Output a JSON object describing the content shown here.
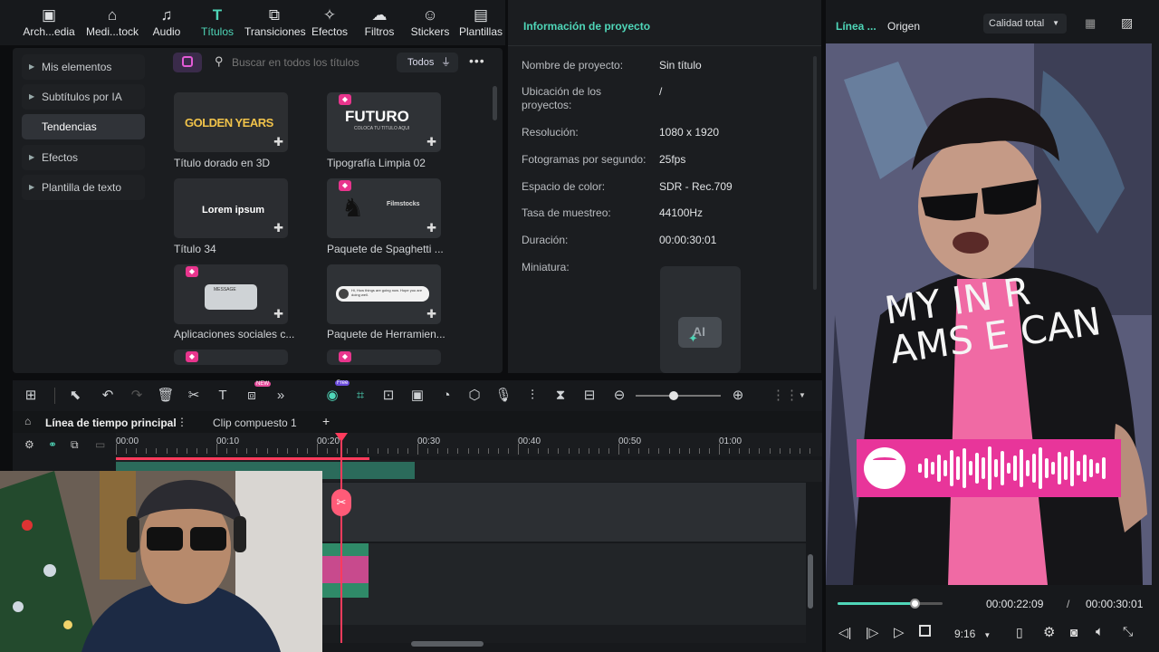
{
  "toolbar": {
    "items": [
      {
        "label": "Arch...edia",
        "icon": "folder-play-icon"
      },
      {
        "label": "Medi...tock",
        "icon": "media-stock-icon"
      },
      {
        "label": "Audio",
        "icon": "music-icon"
      },
      {
        "label": "Títulos",
        "icon": "title-t-icon",
        "active": true
      },
      {
        "label": "Transiciones",
        "icon": "transition-icon"
      },
      {
        "label": "Efectos",
        "icon": "effects-icon"
      },
      {
        "label": "Filtros",
        "icon": "filters-icon"
      },
      {
        "label": "Stickers",
        "icon": "sticker-icon"
      },
      {
        "label": "Plantillas",
        "icon": "templates-icon"
      }
    ]
  },
  "sidebar": {
    "items": [
      {
        "label": "Mis elementos",
        "expandable": true
      },
      {
        "label": "Subtítulos por IA",
        "expandable": true
      },
      {
        "label": "Tendencias",
        "selected": true
      },
      {
        "label": "Efectos",
        "expandable": true
      },
      {
        "label": "Plantilla de texto",
        "expandable": true
      }
    ]
  },
  "search": {
    "placeholder": "Buscar en todos los títulos",
    "filter_label": "Todos"
  },
  "titles": [
    {
      "caption": "Título dorado en 3D",
      "thumb_text": "GOLDEN YEARS"
    },
    {
      "caption": "Tipografía Limpia 02",
      "thumb_text": "FUTURO",
      "thumb_sub": "COLOCA TU TITULO AQUI"
    },
    {
      "caption": "Título 34",
      "thumb_text": "Lorem ipsum"
    },
    {
      "caption": "Paquete de Spaghetti ...",
      "thumb_text": "Filmstocks"
    },
    {
      "caption": "Aplicaciones sociales c...",
      "thumb_text": "MESSAGE"
    },
    {
      "caption": "Paquete de Herramien...",
      "thumb_text": "Hi, How things are going now. Hope you are doing well."
    }
  ],
  "project": {
    "title": "Información de proyecto",
    "rows": [
      {
        "label": "Nombre de proyecto:",
        "value": "Sin título"
      },
      {
        "label": "Ubicación de los proyectos:",
        "value": "/"
      },
      {
        "label": "Resolución:",
        "value": "1080 x 1920"
      },
      {
        "label": "Fotogramas por segundo:",
        "value": "25fps"
      },
      {
        "label": "Espacio de color:",
        "value": "SDR - Rec.709"
      },
      {
        "label": "Tasa de muestreo:",
        "value": "44100Hz"
      },
      {
        "label": "Duración:",
        "value": "00:00:30:01"
      }
    ],
    "thumb_label": "Miniatura:",
    "thumb_icon_text": "AI"
  },
  "preview": {
    "tab_timeline": "Línea ...",
    "tab_source": "Origen",
    "quality": "Calidad total",
    "current_time": "00:00:22:09",
    "separator": "/",
    "total_time": "00:00:30:01",
    "progress": 0.73,
    "ratio": "9:16",
    "jacket_text": "MY IN R AMS E CAN"
  },
  "timeline": {
    "tab_main": "Línea de tiempo principal",
    "tab_compound": "Clip compuesto 1",
    "ticks": [
      "00:00",
      "00:10",
      "00:20",
      "00:30",
      "00:40",
      "00:50",
      "01:00"
    ],
    "zoom_level": 0.45,
    "badges": {
      "new": "NEW",
      "free": "Free"
    }
  },
  "colors": {
    "accent": "#4fd6b8",
    "playhead": "#ff3b5c",
    "spotify_pink": "#e8359a"
  }
}
